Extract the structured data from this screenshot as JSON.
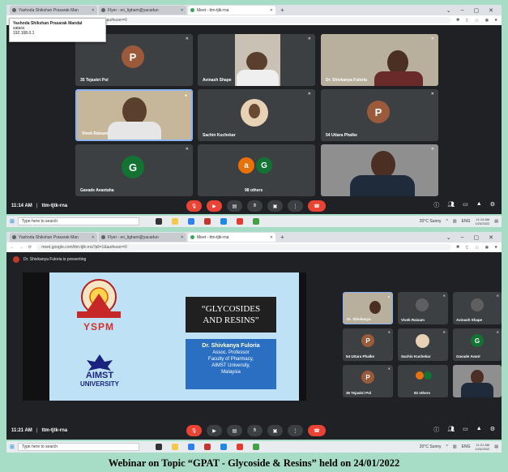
{
  "top": {
    "tabs": [
      {
        "label": "Yashoda Shikshan Prasarak Man"
      },
      {
        "label": "Flyer - en_ligham@yacadun"
      },
      {
        "label": "Meet - ttm-tjtk-rna"
      }
    ],
    "tooltip": {
      "title": "Yashoda Shikshan Prasarak Mandal",
      "line2": "satara",
      "line3": "192.168.0.1"
    },
    "url": "meet.google.com/ttm-tjtk-rna?pli=1&authuser=0",
    "tiles": [
      {
        "name": "35 Tejaskri Pol",
        "initial": "P"
      },
      {
        "name": "Avinash Shape"
      },
      {
        "name": "Dr. Shivkanya Fuloria"
      },
      {
        "name": "Vivek Raisam"
      },
      {
        "name": "Sachin Kuchekar"
      },
      {
        "name": "54 Uttara Phalke",
        "initial": "P"
      },
      {
        "name": "Gavade Avantaha",
        "initial": "G"
      },
      {
        "name": "98 others",
        "initials": [
          "a",
          "G"
        ]
      },
      {
        "name": ""
      }
    ],
    "time": "11:14 AM",
    "meeting_code": "ttm-tjtk-rna"
  },
  "taskbar1": {
    "search": "Type here to search",
    "weather": "20°C Sunny",
    "lang": "ENG",
    "clock_time": "11:14 AM",
    "clock_date": "1/24/2022"
  },
  "bottom": {
    "tabs": [
      {
        "label": "Yashoda Shikshan Prasarak Man"
      },
      {
        "label": "Flyer - en_ligham@yacadun"
      },
      {
        "label": "Meet - ttm-tjtk-rna"
      }
    ],
    "url": "meet.google.com/ttm-tjtk-rna?pli=1&authuser=0",
    "presenting": "Dr. Shivkanya Fuloria is presenting",
    "slide": {
      "ysp_text": "YSPM",
      "aimst_text": "AIMST",
      "aimst_text2": "UNIVERSITY",
      "title_line1": "“GLYCOSIDES",
      "title_line2": "AND RESINS”",
      "presenter": "Dr. Shivkanya Fuloria",
      "role": "Assoc. Professor",
      "dept": "Faculty of Pharmacy,",
      "univ": "AIMST University,",
      "country": "Malaysia"
    },
    "tiles": [
      {
        "name": "Dr. Shivkanya"
      },
      {
        "name": "Vivek Raisam"
      },
      {
        "name": "Avinash Shape"
      },
      {
        "name": "54 Uttara Phalke",
        "initial": "P"
      },
      {
        "name": "Sachin Kuchekar"
      },
      {
        "name": "Gavade Avant",
        "initial": "G"
      },
      {
        "name": "35 Tejaskri Pol",
        "initial": "P"
      },
      {
        "name": "92 others"
      },
      {
        "name": ""
      }
    ],
    "time": "11:21 AM",
    "meeting_code": "ttm-tjtk-rna"
  },
  "taskbar2": {
    "search": "Type here to search",
    "weather": "20°C Sunny",
    "lang": "ENG",
    "clock_time": "11:21 AM",
    "clock_date": "1/24/2022"
  },
  "caption": "Webinar on Topic “GPAT - Glycoside & Resins” held  on 24/01/2022",
  "colors": {
    "meet_dark": "#202124",
    "tile": "#3c4043",
    "end_call": "#ea4335",
    "avatar_brown": "#9b5b3b",
    "avatar_green": "#137333",
    "background": "#a7dcc6"
  }
}
